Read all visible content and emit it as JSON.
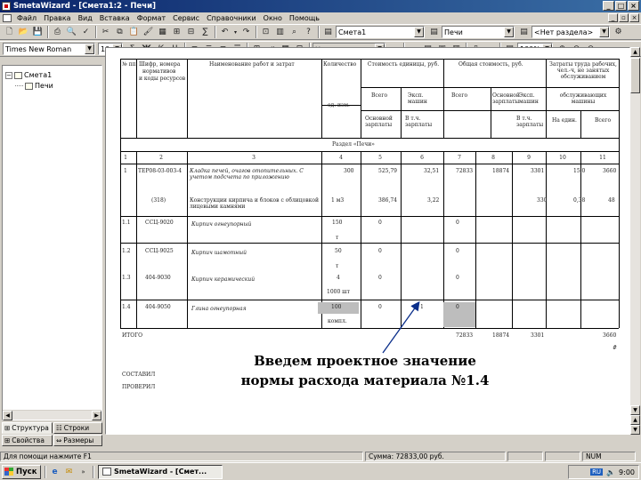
{
  "title": "SmetaWizard - [Смета1:2 - Печи]",
  "menu": [
    "Файл",
    "Правка",
    "Вид",
    "Вставка",
    "Формат",
    "Сервис",
    "Справочники",
    "Окно",
    "Помощь"
  ],
  "toolbar1": {
    "smeta_combo": "Смета1",
    "razdel_combo": "Печи",
    "podrazdel_combo": "<Нет раздела>"
  },
  "toolbar2": {
    "font": "Times New Roman",
    "size": "10",
    "bold": "Ж",
    "italic": "К",
    "underline": "Ч",
    "style_combo": "Не составленные",
    "zoom": "100%"
  },
  "tree": {
    "root": "Смета1",
    "child": "Печи"
  },
  "panel_tabs": [
    "Структура",
    "Строки",
    "Свойства",
    "Размеры"
  ],
  "doc": {
    "header": {
      "col1": "№ пп",
      "col2a": "Шифр, номера",
      "col2b": "нормативов",
      "col2c": "и коды ресурсов",
      "col3": "Наименование работ и затрат",
      "col4": "Количество",
      "col4b": "ед. изм.",
      "col5": "Стоимость единицы, руб.",
      "col5b": "Всего",
      "col5c": "Эксп. машин",
      "col5d": "Основной зарплаты",
      "col5e": "В т.ч. зарплаты",
      "col6": "Общая стоимость, руб.",
      "col6b": "Всего",
      "col6c": "Основной зарплаты",
      "col6d": "Эксп. машин",
      "col6e": "В т.ч. зарплаты",
      "col7": "Затраты труда рабочих, чел.-ч, не занятых обслуживанием",
      "col7b": "обслуживающих машины",
      "col7c": "На един.",
      "col7d": "Всего"
    },
    "section": "Раздел «Печи»",
    "col_nums": [
      "1",
      "2",
      "3",
      "4",
      "5",
      "6",
      "7",
      "8",
      "9",
      "10",
      "11"
    ],
    "rows": [
      {
        "n": "1",
        "code": "ТЕР08-03-003-4",
        "name": "Кладка печей, очагов отопительных. С учетом подсчета по приложению",
        "qty": "300",
        "c5": "525,79",
        "c6": "32,51",
        "c7": "72833",
        "c8": "18874",
        "c9": "3301",
        "c10": "15,0",
        "c11": "3660"
      },
      {
        "n": "",
        "code": "(318)",
        "name": "Конструкции кирпича и блоков с облицовкой лицевыми камнями",
        "qty": "1 м3",
        "c5": "386,74",
        "c6": "3,22",
        "c7": "",
        "c8": "",
        "c9": "330",
        "c10": "0,38",
        "c11": "48"
      },
      {
        "n": "1.1",
        "code": "ССЦ-9020",
        "name": "Кирпич огнеупорный",
        "qty": "150",
        "unit": "т",
        "c5": "0",
        "c7": "0"
      },
      {
        "n": "1.2",
        "code": "ССЦ-9025",
        "name": "Кирпич шамотный",
        "qty": "50",
        "unit": "т",
        "c5": "0",
        "c7": "0"
      },
      {
        "n": "1.3",
        "code": "404-9030",
        "name": "Кирпич керамический",
        "qty": "4",
        "unit": "1000 шт",
        "c5": "0",
        "c7": "0"
      },
      {
        "n": "1.4",
        "code": "404-9050",
        "name": "Глина огнеупорная",
        "qty": "100",
        "unit": "компл.",
        "c5": "0",
        "c6": "1",
        "c7": "0"
      }
    ],
    "itogo": "ИТОГО",
    "itogo_vals": {
      "c7": "72833",
      "c8": "18874",
      "c9": "3301",
      "c11": "3660"
    },
    "sostavil": "СОСТАВИЛ",
    "proveril": "ПРОВЕРИЛ",
    "star": "#"
  },
  "callout": {
    "line1": "Введем проектное значение",
    "line2": "нормы расхода материала №1.4"
  },
  "status": {
    "hint": "Для помощи нажмите F1",
    "total": "Сумма: 72833,00 руб.",
    "num": "NUM"
  },
  "taskbar": {
    "start": "Пуск",
    "task": "SmetaWizard - [Смет...",
    "clock": "9:00",
    "lang": "RU"
  }
}
